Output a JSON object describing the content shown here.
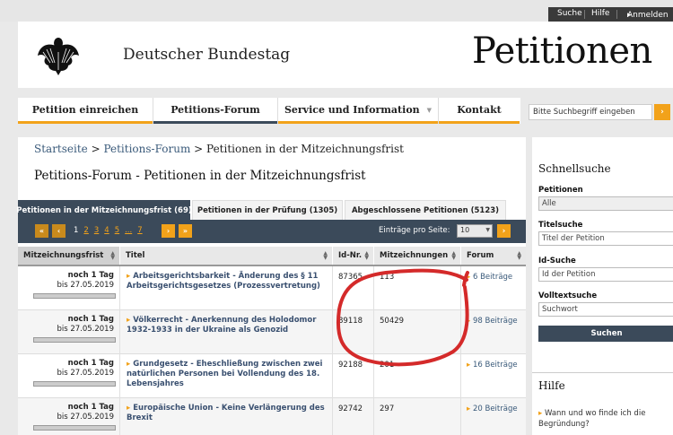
{
  "topbar": {
    "search": "Suche",
    "help": "Hilfe",
    "login": "Anmelden"
  },
  "header": {
    "brand": "Deutscher Bundestag",
    "site_title": "Petitionen",
    "logo_icon": "federal-eagle-icon"
  },
  "nav": {
    "items": [
      {
        "label": "Petition einreichen"
      },
      {
        "label": "Petitions-Forum"
      },
      {
        "label": "Service und Information"
      },
      {
        "label": "Kontakt"
      }
    ],
    "search_placeholder": "Bitte Suchbegriff eingeben",
    "search_go": "›"
  },
  "breadcrumb": {
    "home": "Startseite",
    "sep1": " > ",
    "forum": "Petitions-Forum",
    "sep2": " > ",
    "current": "Petitionen in der Mitzeichnungsfrist"
  },
  "page_title": "Petitions-Forum - Petitionen in der Mitzeichnungsfrist",
  "tabs": [
    {
      "label": "Petitionen in der Mitzeichnungsfrist (69)"
    },
    {
      "label": "Petitionen in der Prüfung (1305)"
    },
    {
      "label": "Abgeschlossene Petitionen (5123)"
    }
  ],
  "pager": {
    "first": "«",
    "prev": "‹",
    "pages": [
      "1",
      "2",
      "3",
      "4",
      "5",
      "...",
      "7"
    ],
    "next": "›",
    "last": "»",
    "per_page_label": "Einträge pro Seite:",
    "per_page_value": "10",
    "go": "›"
  },
  "table": {
    "headers": [
      "Mitzeichnungsfrist",
      "Titel",
      "Id-Nr.",
      "Mitzeichnungen",
      "Forum"
    ],
    "rows": [
      {
        "deadline": "noch 1 Tag",
        "date": "bis 27.05.2019",
        "title": "Arbeitsgerichtsbarkeit - Änderung des § 11 Arbeitsgerichtsgesetzes (Prozessvertretung)",
        "id": "87365",
        "signatures": "113",
        "forum": "6 Beiträge"
      },
      {
        "deadline": "noch 1 Tag",
        "date": "bis 27.05.2019",
        "title": "Völkerrecht - Anerkennung des Holodomor 1932-1933 in der Ukraine als Genozid",
        "id": "89118",
        "signatures": "50429",
        "forum": "98 Beiträge"
      },
      {
        "deadline": "noch 1 Tag",
        "date": "bis 27.05.2019",
        "title": "Grundgesetz - Eheschließung zwischen zwei natürlichen Personen bei Vollendung des 18. Lebensjahres",
        "id": "92188",
        "signatures": "201",
        "forum": "16 Beiträge"
      },
      {
        "deadline": "noch 1 Tag",
        "date": "bis 27.05.2019",
        "title": "Europäische Union - Keine Verlängerung des Brexit",
        "id": "92742",
        "signatures": "297",
        "forum": "20 Beiträge"
      }
    ]
  },
  "sidebar": {
    "heading": "Schnellsuche",
    "petitions_label": "Petitionen",
    "petitions_value": "Alle",
    "title_label": "Titelsuche",
    "title_placeholder": "Titel der Petition",
    "id_label": "Id-Suche",
    "id_placeholder": "Id der Petition",
    "fulltext_label": "Volltextsuche",
    "fulltext_placeholder": "Suchwort",
    "search_button": "Suchen",
    "help_heading": "Hilfe",
    "help_link": "Wann und wo finde ich die Begründung?"
  },
  "colors": {
    "accent": "#f2a21a",
    "nav_dark": "#3b4a5a",
    "annotation": "#d42a2a"
  }
}
